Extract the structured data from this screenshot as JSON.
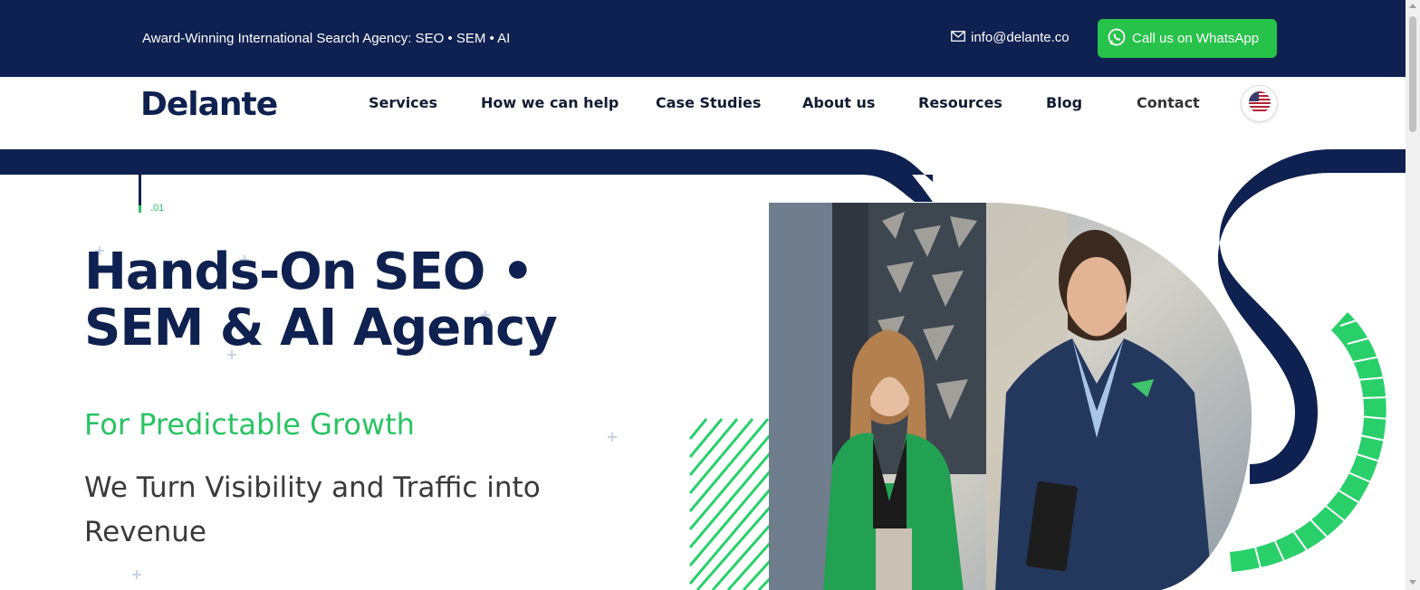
{
  "topbar": {
    "tagline": "Award-Winning International Search Agency: SEO • SEM • AI",
    "email": "info@delante.co",
    "email_icon": "mail-icon",
    "whatsapp_label": "Call us on WhatsApp",
    "whatsapp_icon": "whatsapp-icon"
  },
  "nav": {
    "logo": "Delante",
    "items": [
      {
        "label": "Services"
      },
      {
        "label": "How we can help"
      },
      {
        "label": "Case Studies"
      },
      {
        "label": "About us"
      },
      {
        "label": "Resources"
      },
      {
        "label": "Blog"
      },
      {
        "label": "Contact"
      }
    ],
    "language_icon": "us-flag-icon"
  },
  "hero": {
    "index": ".01",
    "title_line1": "Hands-On SEO •",
    "title_line2": "SEM & AI Agency",
    "subtitle": "For Predictable Growth",
    "lead": "We Turn Visibility and Traffic into Revenue"
  },
  "colors": {
    "navy": "#0e2150",
    "green": "#29c463",
    "whatsapp_green": "#27c24a"
  }
}
